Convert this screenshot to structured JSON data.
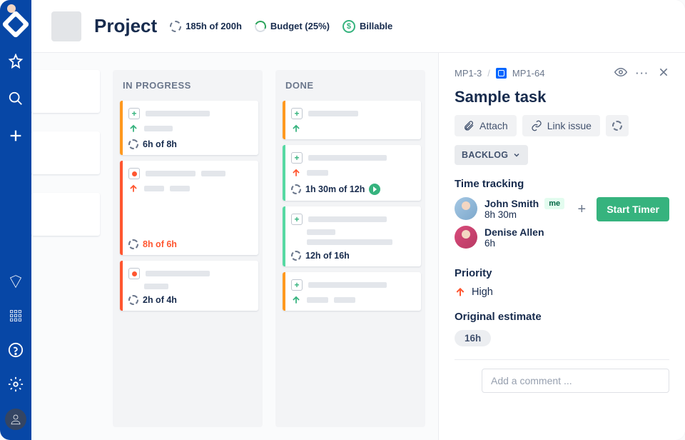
{
  "header": {
    "title": "Project",
    "stat1": "185h of 200h",
    "stat2": "Budget (25%)",
    "stat3": "Billable"
  },
  "columns": {
    "inprogress": {
      "title": "IN PROGRESS"
    },
    "done": {
      "title": "DONE"
    }
  },
  "cards": {
    "ip1": "6h of 8h",
    "ip2": "8h of 6h",
    "ip3": "2h of 4h",
    "d1": "",
    "d2": "1h 30m of 12h",
    "d3": "12h of 16h"
  },
  "detail": {
    "crumb1": "MP1-3",
    "crumb2": "MP1-64",
    "title": "Sample task",
    "attach": "Attach",
    "link": "Link issue",
    "status": "BACKLOG",
    "section_tracking": "Time tracking",
    "user1_name": "John Smith",
    "user1_me": "me",
    "user1_time": "8h 30m",
    "user2_name": "Denise Allen",
    "user2_time": "6h",
    "start_timer": "Start Timer",
    "section_priority": "Priority",
    "priority_value": "High",
    "section_estimate": "Original estimate",
    "estimate_value": "16h",
    "comment_placeholder": "Add a comment ..."
  }
}
